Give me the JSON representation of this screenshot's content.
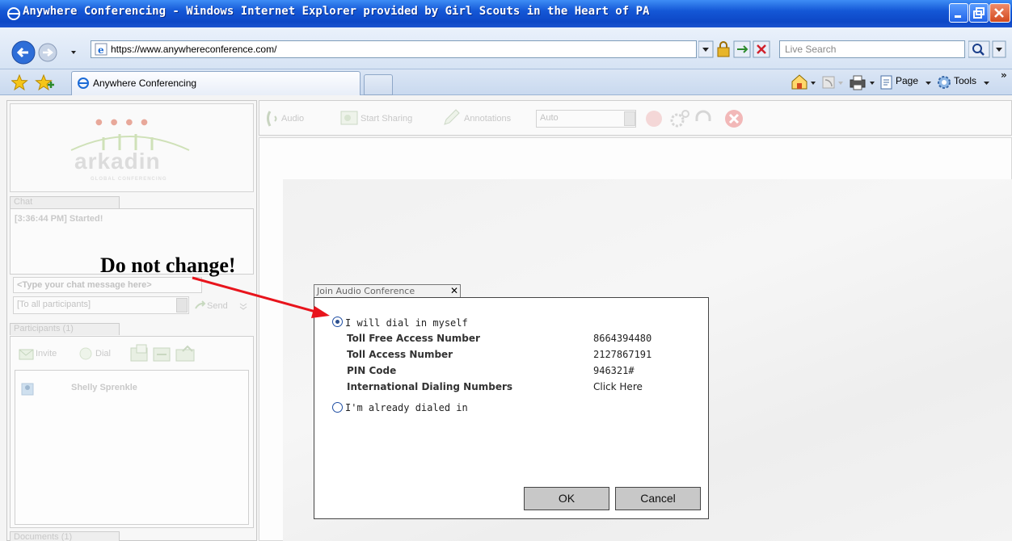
{
  "window": {
    "title": "Anywhere Conferencing - Windows Internet Explorer provided by Girl Scouts in the Heart of PA"
  },
  "address_bar": {
    "url": "https://www.anywhereconference.com/",
    "search_placeholder": "Live Search"
  },
  "tabs": [
    {
      "label": "Anywhere Conferencing"
    }
  ],
  "command_bar": {
    "page_label": "Page",
    "tools_label": "Tools"
  },
  "app": {
    "logo_text": "arkadin",
    "logo_subtext": "GLOBAL CONFERENCING",
    "chat": {
      "tab_label": "Chat",
      "log_line": "[3:36:44 PM] Started!",
      "message_placeholder": "<Type your chat message here>",
      "recipient": "[To all participants]",
      "send_label": "Send"
    },
    "participants": {
      "tab_label": "Participants (1)",
      "invite_label": "Invite",
      "dial_label": "Dial",
      "list": [
        "Shelly Sprenkle"
      ]
    },
    "documents": {
      "tab_label": "Documents (1)"
    },
    "toolbar": {
      "audio_label": "Audio",
      "start_sharing_label": "Start Sharing",
      "annotations_label": "Annotations",
      "zoom_value": "Auto"
    }
  },
  "dialog": {
    "title": "Join Audio Conference",
    "option_dial_in": "I will dial in myself",
    "option_already": "I'm already dialed in",
    "details": [
      {
        "label": "Toll Free Access Number",
        "value": "8664394480"
      },
      {
        "label": "Toll Access Number",
        "value": "2127867191"
      },
      {
        "label": "PIN Code",
        "value": "946321#"
      },
      {
        "label": "International Dialing Numbers",
        "value": "Click Here"
      }
    ],
    "ok_label": "OK",
    "cancel_label": "Cancel"
  },
  "annotation": {
    "text": "Do not change!",
    "color": "#e8141c"
  },
  "colors": {
    "titlebar": "#1457d6",
    "dialog_button": "#c8c8c8"
  }
}
